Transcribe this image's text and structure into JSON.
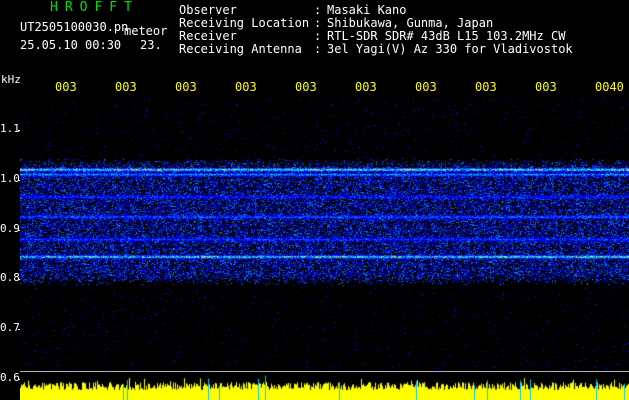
{
  "header": {
    "app_title": "HROFFT",
    "file_name": "UT2505100030.pn",
    "file_tag": "meteor",
    "date_time": "25.05.10 00:30",
    "count": "23."
  },
  "info": [
    {
      "label": "Observer",
      "value": "Masaki Kano"
    },
    {
      "label": "Receiving Location",
      "value": "Shibukawa, Gunma, Japan"
    },
    {
      "label": "Receiver",
      "value": "RTL-SDR SDR# 43dB L15 103.2MHz CW"
    },
    {
      "label": "Receiving Antenna",
      "value": "3el Yagi(V) Az 330 for Vladivostok"
    }
  ],
  "axis": {
    "unit": "kHz",
    "freq_labels": [
      "1.1",
      "1.0",
      "0.9",
      "0.8",
      "0.7",
      "0.6"
    ],
    "time_labels": [
      "003",
      "003",
      "003",
      "003",
      "003",
      "003",
      "003",
      "003",
      "003",
      "0040"
    ]
  },
  "colors": {
    "title": "#00e000",
    "text": "#ffffff",
    "time_label": "#ffff00",
    "background": "#000000",
    "level_bar": "#ffff00",
    "level_spike": "#00c8ff"
  },
  "spectrum": {
    "freq_min": 0.6,
    "freq_max": 1.15,
    "noise_band": [
      0.78,
      1.02
    ],
    "carrier_lines": [
      {
        "freq": 1.005,
        "strength": 1.0
      },
      {
        "freq": 0.995,
        "strength": 0.7
      },
      {
        "freq": 0.95,
        "strength": 0.45
      },
      {
        "freq": 0.91,
        "strength": 0.6
      },
      {
        "freq": 0.865,
        "strength": 0.45
      },
      {
        "freq": 0.83,
        "strength": 0.95
      }
    ]
  }
}
